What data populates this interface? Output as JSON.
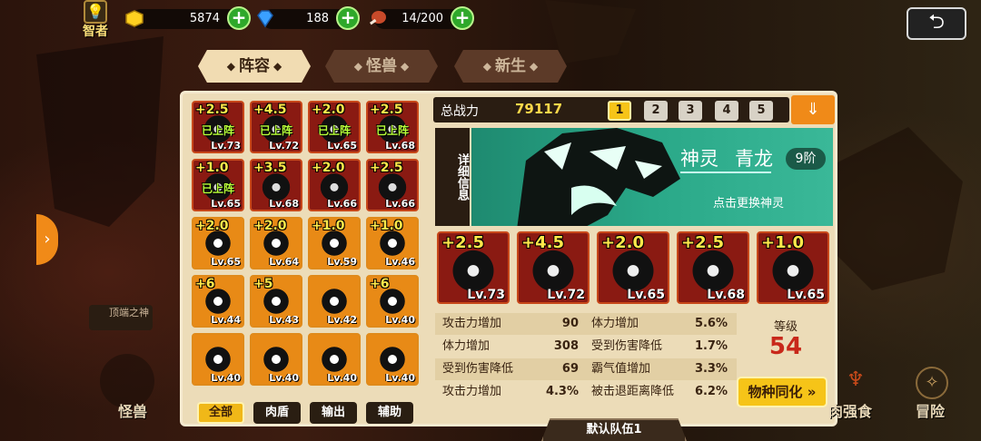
{
  "topbar": {
    "rank_label": "智者",
    "gold": "5874",
    "gems": "188",
    "stamina": "14/200"
  },
  "tabs": [
    {
      "label": "阵容",
      "active": true
    },
    {
      "label": "怪兽",
      "active": false
    },
    {
      "label": "新生",
      "active": false
    }
  ],
  "roster": [
    {
      "stars": "+2.5",
      "level": "Lv.73",
      "status": "已上阵"
    },
    {
      "stars": "+4.5",
      "level": "Lv.72",
      "status": "已上阵"
    },
    {
      "stars": "+2.0",
      "level": "Lv.65",
      "status": "已上阵"
    },
    {
      "stars": "+2.5",
      "level": "Lv.68",
      "status": "已上阵"
    },
    {
      "stars": "+1.0",
      "level": "Lv.65",
      "status": "已上阵"
    },
    {
      "stars": "+3.5",
      "level": "Lv.68",
      "status": ""
    },
    {
      "stars": "+2.0",
      "level": "Lv.66",
      "status": ""
    },
    {
      "stars": "+2.5",
      "level": "Lv.66",
      "status": ""
    },
    {
      "stars": "+2.0",
      "level": "Lv.65",
      "status": ""
    },
    {
      "stars": "+2.0",
      "level": "Lv.64",
      "status": ""
    },
    {
      "stars": "+1.0",
      "level": "Lv.59",
      "status": ""
    },
    {
      "stars": "+1.0",
      "level": "Lv.46",
      "status": ""
    },
    {
      "stars": "+6",
      "level": "Lv.44",
      "status": ""
    },
    {
      "stars": "+5",
      "level": "Lv.43",
      "status": ""
    },
    {
      "stars": "",
      "level": "Lv.42",
      "status": ""
    },
    {
      "stars": "+6",
      "level": "Lv.40",
      "status": ""
    },
    {
      "stars": "",
      "level": "Lv.40",
      "status": ""
    },
    {
      "stars": "",
      "level": "Lv.40",
      "status": ""
    },
    {
      "stars": "",
      "level": "Lv.40",
      "status": ""
    },
    {
      "stars": "",
      "level": "Lv.40",
      "status": ""
    }
  ],
  "filters": {
    "all": "全部",
    "tank": "肉盾",
    "dps": "输出",
    "support": "辅助"
  },
  "power": {
    "label": "总战力",
    "value": "79117"
  },
  "team_slots": [
    "1",
    "2",
    "3",
    "4",
    "5"
  ],
  "detail_label": "详细信息",
  "spirit": {
    "type": "神灵",
    "name": "青龙",
    "stage": "9阶",
    "change": "点击更换神灵"
  },
  "team": [
    {
      "stars": "+2.5",
      "level": "Lv.73"
    },
    {
      "stars": "+4.5",
      "level": "Lv.72"
    },
    {
      "stars": "+2.0",
      "level": "Lv.65"
    },
    {
      "stars": "+2.5",
      "level": "Lv.68"
    },
    {
      "stars": "+1.0",
      "level": "Lv.65"
    }
  ],
  "stats": [
    {
      "label": "攻击力增加",
      "value": "90"
    },
    {
      "label": "体力增加",
      "value": "5.6%"
    },
    {
      "label": "体力增加",
      "value": "308"
    },
    {
      "label": "受到伤害降低",
      "value": "1.7%"
    },
    {
      "label": "受到伤害降低",
      "value": "69"
    },
    {
      "label": "霸气值增加",
      "value": "3.3%"
    },
    {
      "label": "攻击力增加",
      "value": "4.3%"
    },
    {
      "label": "被击退距离降低",
      "value": "6.2%"
    }
  ],
  "level": {
    "label": "等级",
    "value": "54"
  },
  "sync_button": "物种同化",
  "team_name": "默认队伍1",
  "side_tag": "顶端之神",
  "bottom_nav": {
    "monster": "怪兽",
    "enhance": "肉强食",
    "adventure": "冒险"
  },
  "colors": {
    "accent": "#f6c418",
    "panel": "#ecdcb8",
    "spirit": "#2aa888",
    "plus": "#2ea82a"
  }
}
